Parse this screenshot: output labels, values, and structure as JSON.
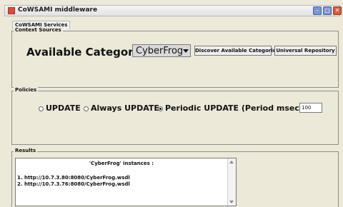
{
  "window": {
    "title": "CoWSAMI middleware"
  },
  "tabs": [
    {
      "label": "CoWSAMI Services"
    }
  ],
  "context_sources": {
    "legend": "Context Sources",
    "available_label": "Available Categories :",
    "selected_category": "CyberFrog",
    "discover_button": "Discover Available Categories",
    "universal_button": "Universal Repository"
  },
  "policies": {
    "legend": "Policies",
    "options": [
      {
        "label": "UPDATE",
        "checked": false
      },
      {
        "label": "Always UPDATE",
        "checked": false
      },
      {
        "label": "Periodic UPDATE (Period msec) :",
        "checked": true
      }
    ],
    "period_value": "100"
  },
  "results": {
    "legend": "Results",
    "title": "'CyberFrog' instances :",
    "lines": [
      "1. http://10.7.3.80:8080/CyberFrog.wsdl",
      "2. http://10.7.3.76:8080/CyberFrog.wsdl"
    ]
  }
}
